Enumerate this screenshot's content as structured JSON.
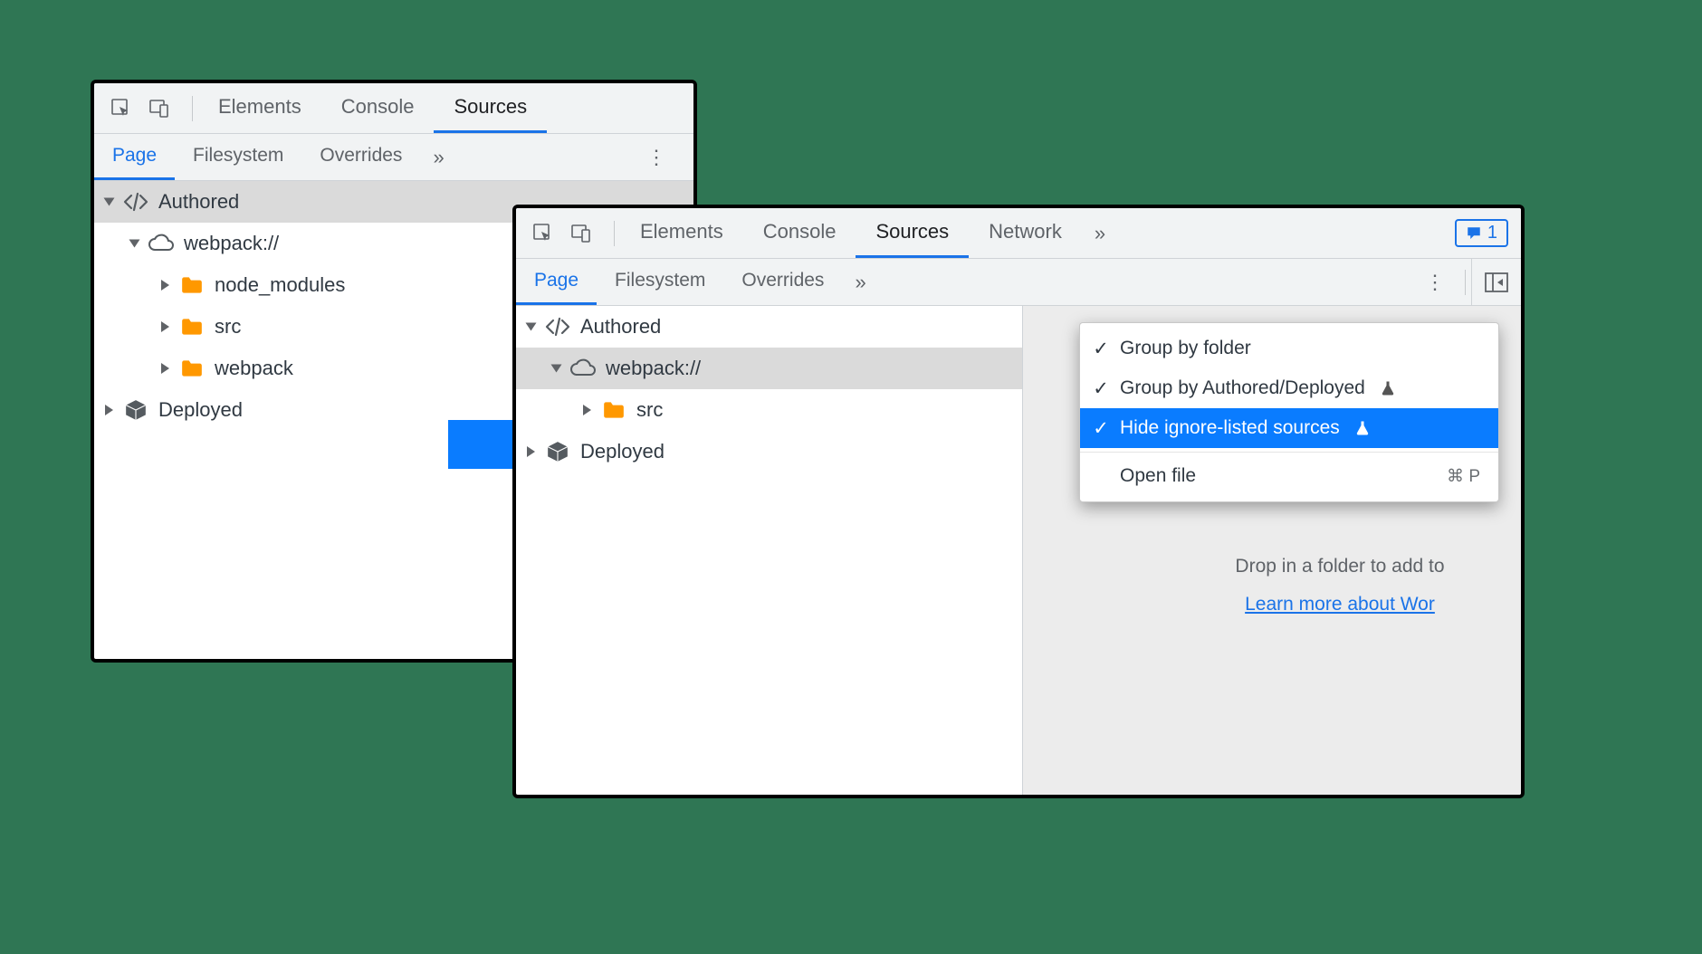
{
  "colors": {
    "background": "#2f7654",
    "accent": "#1a73e8",
    "folder": "#ff9800",
    "arrow": "#0a7cff",
    "menu_highlight": "#0a7cff"
  },
  "left_window": {
    "tabbar": {
      "tabs": [
        {
          "label": "Elements",
          "active": false
        },
        {
          "label": "Console",
          "active": false
        },
        {
          "label": "Sources",
          "active": true
        }
      ]
    },
    "subbar": {
      "tabs": [
        {
          "label": "Page",
          "active": true
        },
        {
          "label": "Filesystem",
          "active": false
        },
        {
          "label": "Overrides",
          "active": false
        }
      ],
      "overflow": "»"
    },
    "tree": {
      "authored_label": "Authored",
      "webpack_label": "webpack://",
      "folders": [
        {
          "label": "node_modules"
        },
        {
          "label": "src"
        },
        {
          "label": "webpack"
        }
      ],
      "deployed_label": "Deployed"
    }
  },
  "right_window": {
    "tabbar": {
      "tabs": [
        {
          "label": "Elements",
          "active": false
        },
        {
          "label": "Console",
          "active": false
        },
        {
          "label": "Sources",
          "active": true
        },
        {
          "label": "Network",
          "active": false
        }
      ],
      "overflow": "»",
      "badge_count": "1"
    },
    "subbar": {
      "tabs": [
        {
          "label": "Page",
          "active": true
        },
        {
          "label": "Filesystem",
          "active": false
        },
        {
          "label": "Overrides",
          "active": false
        }
      ],
      "overflow": "»"
    },
    "tree": {
      "authored_label": "Authored",
      "webpack_label": "webpack://",
      "folders": [
        {
          "label": "src"
        }
      ],
      "deployed_label": "Deployed"
    },
    "menu": {
      "items": [
        {
          "label": "Group by folder",
          "checked": true,
          "highlighted": false,
          "experiment": false
        },
        {
          "label": "Group by Authored/Deployed",
          "checked": true,
          "highlighted": false,
          "experiment": true
        },
        {
          "label": "Hide ignore-listed sources",
          "checked": true,
          "highlighted": true,
          "experiment": true
        }
      ],
      "open_file_label": "Open file",
      "open_file_shortcut": "⌘ P"
    },
    "helper": {
      "line": "Drop in a folder to add to",
      "link": "Learn more about Wor"
    }
  }
}
